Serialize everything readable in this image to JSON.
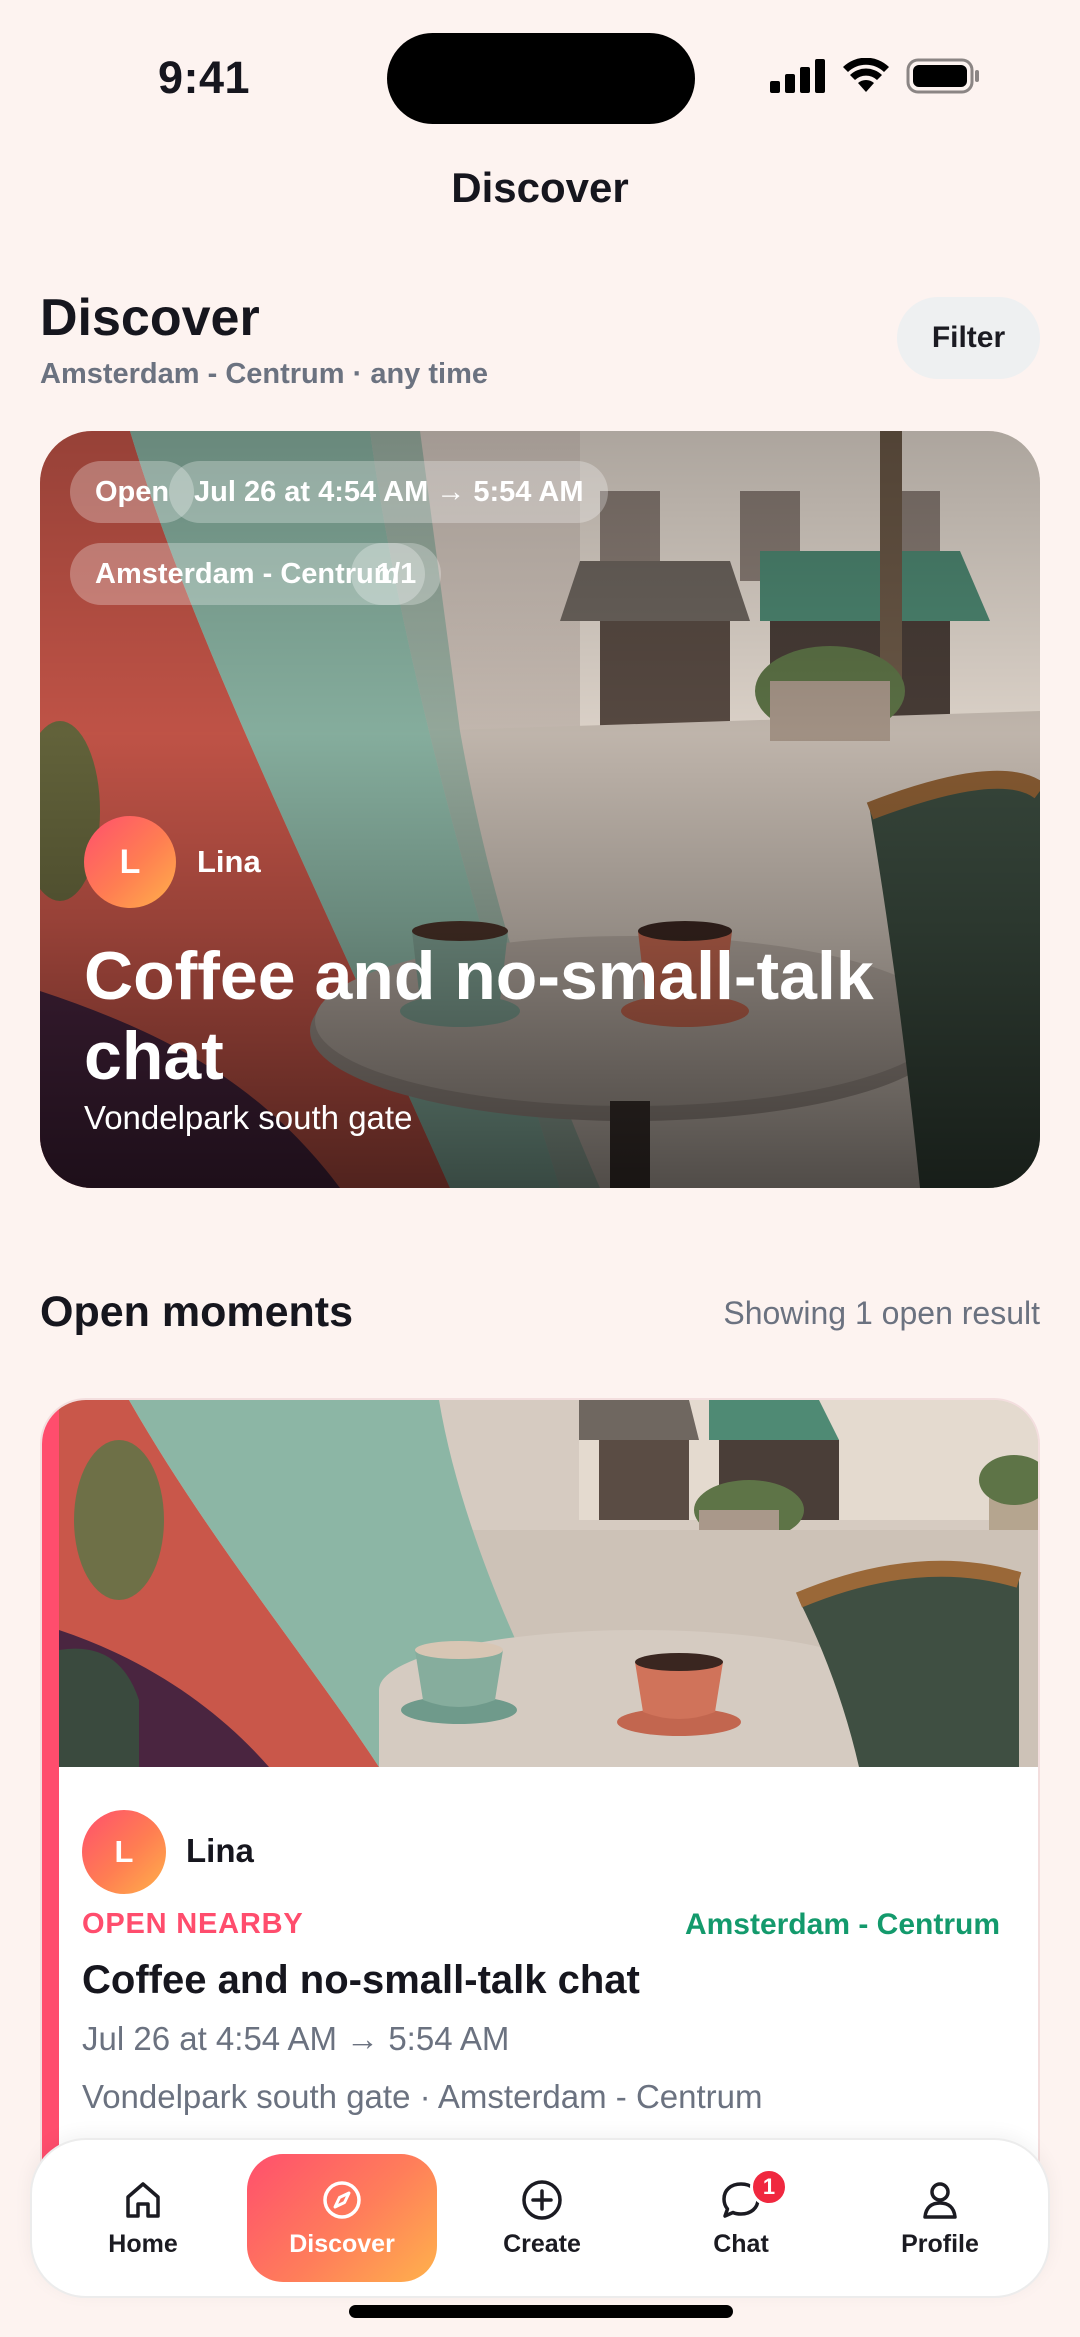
{
  "status_bar": {
    "time": "9:41"
  },
  "nav": {
    "title": "Discover"
  },
  "header": {
    "title": "Discover",
    "subtitle": "Amsterdam - Centrum · any time",
    "filter_label": "Filter"
  },
  "featured": {
    "chips": [
      "Open",
      "Jul 26 at 4:54 AM → 5:54 AM",
      "Amsterdam - Centrum",
      "1/1"
    ],
    "host_initial": "L",
    "host_name": "Lina",
    "title": "Coffee and no-small-talk chat",
    "location": "Vondelpark south gate"
  },
  "section": {
    "title": "Open moments",
    "count_text": "Showing 1 open result"
  },
  "card": {
    "host_initial": "L",
    "host_name": "Lina",
    "status": "OPEN NEARBY",
    "area": "Amsterdam - Centrum",
    "title": "Coffee and no-small-talk chat",
    "time": "Jul 26 at 4:54 AM → 5:54 AM",
    "location": "Vondelpark south gate · Amsterdam - Centrum"
  },
  "tabbar": {
    "items": [
      {
        "label": "Home",
        "icon": "home-icon",
        "active": false
      },
      {
        "label": "Discover",
        "icon": "compass-icon",
        "active": true
      },
      {
        "label": "Create",
        "icon": "plus-circle-icon",
        "active": false
      },
      {
        "label": "Chat",
        "icon": "chat-bubble-icon",
        "active": false,
        "badge": "1"
      },
      {
        "label": "Profile",
        "icon": "person-icon",
        "active": false
      }
    ]
  },
  "colors": {
    "background": "#fdf3f0",
    "accent_pink": "#ff4d6d",
    "accent_orange": "#ffb24c",
    "area_green": "#139a6c",
    "muted_text": "#6b7280"
  }
}
